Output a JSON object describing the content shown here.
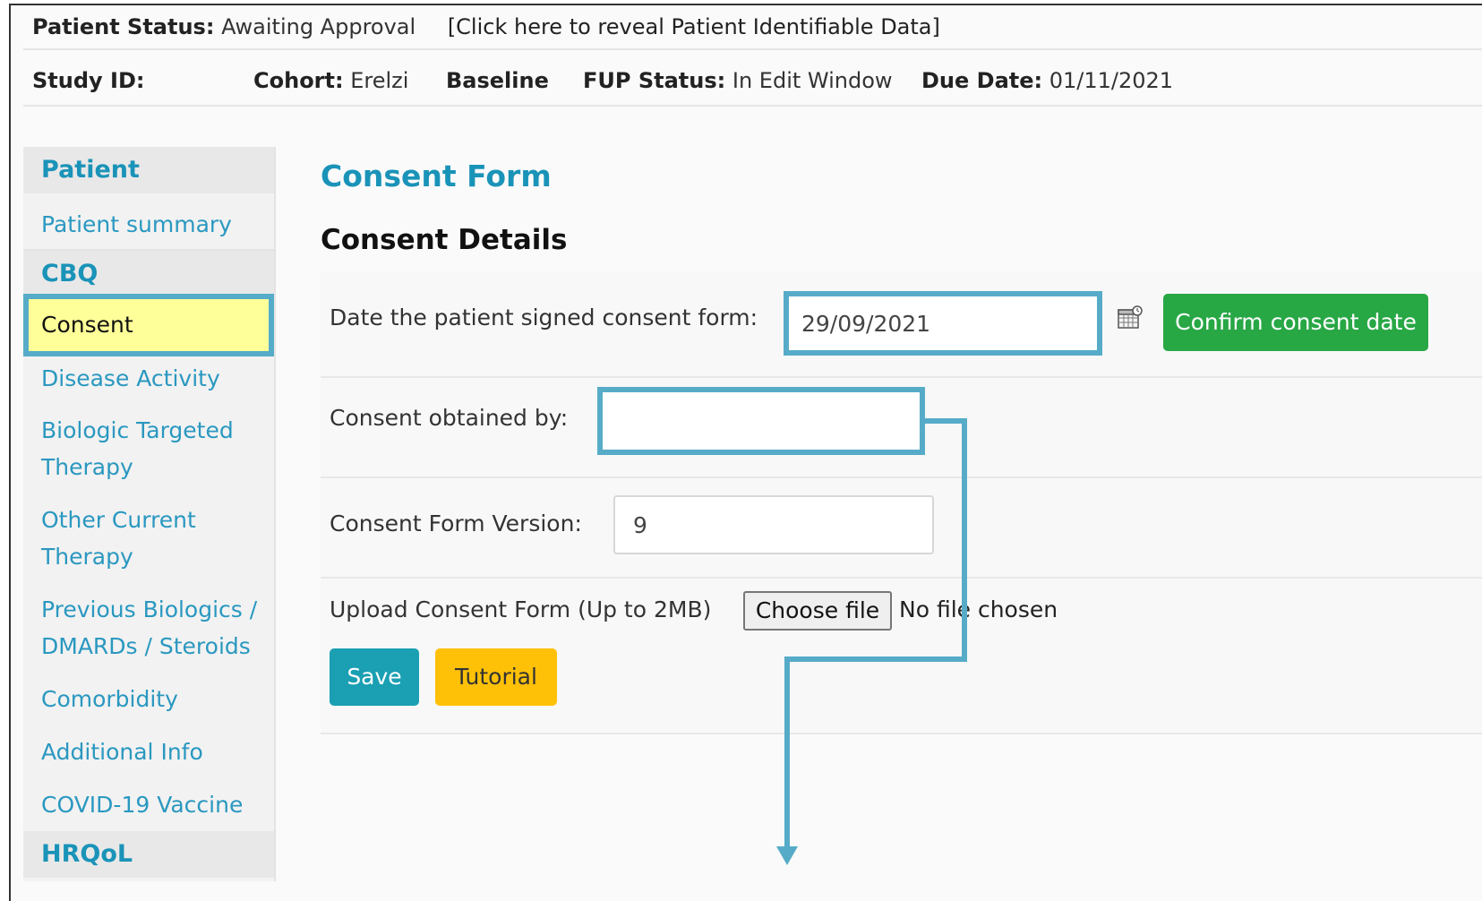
{
  "header": {
    "patient_status_label": "Patient Status:",
    "patient_status_value": "Awaiting Approval",
    "reveal_link": "[Click here to reveal Patient Identifiable Data]",
    "study_id_label": "Study ID:",
    "study_id_value": "",
    "cohort_label": "Cohort:",
    "cohort_value": "Erelzi",
    "visit": "Baseline",
    "fup_label": "FUP Status:",
    "fup_value": "In Edit Window",
    "due_label": "Due Date:",
    "due_value": "01/11/2021"
  },
  "sidebar": {
    "sections": [
      {
        "title": "Patient",
        "items": [
          "Patient summary"
        ]
      },
      {
        "title": "CBQ",
        "items": [
          "Consent",
          "Disease Activity",
          "Biologic Targeted Therapy",
          "Other Current Therapy",
          "Previous Biologics / DMARDs / Steroids",
          "Comorbidity",
          "Additional Info",
          "COVID-19 Vaccine"
        ]
      },
      {
        "title": "HRQoL",
        "items": []
      }
    ],
    "active_item": "Consent"
  },
  "main": {
    "title": "Consent Form",
    "section_title": "Consent Details",
    "fields": {
      "signed_date_label": "Date the patient signed consent form:",
      "signed_date_value": "29/09/2021",
      "confirm_button": "Confirm consent date",
      "obtained_by_label": "Consent obtained by:",
      "obtained_by_value": "",
      "version_label": "Consent Form Version:",
      "version_value": "9",
      "upload_label": "Upload Consent Form (Up to 2MB)",
      "choose_file_button": "Choose file",
      "no_file_text": "No file chosen"
    },
    "buttons": {
      "save": "Save",
      "tutorial": "Tutorial"
    }
  },
  "icons": {
    "calendar": "calendar-icon"
  },
  "colors": {
    "accent": "#1a93b8",
    "highlight_border": "#56acc8",
    "active_bg": "#ffff99",
    "confirm_green": "#28a745",
    "save_teal": "#1a9fb3",
    "tutorial_yellow": "#ffc107"
  }
}
